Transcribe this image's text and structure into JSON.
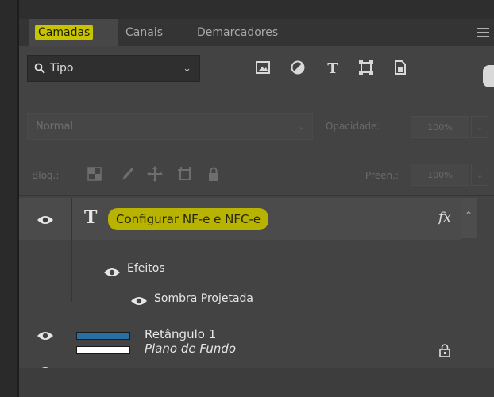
{
  "tabs": [
    {
      "label": "Camadas"
    },
    {
      "label": "Canais"
    },
    {
      "label": "Demarcadores"
    }
  ],
  "filter": {
    "label": "Tipo"
  },
  "blend": {
    "mode": "Normal",
    "opacity_label": "Opacidade:",
    "opacity_value": "100%"
  },
  "lock": {
    "label": "Bloq.:",
    "fill_label": "Preen.:",
    "fill_value": "100%"
  },
  "layers": {
    "text_layer": {
      "name": "Configurar NF-e e NFC-e",
      "fx": "fx"
    },
    "effects": {
      "label": "Efeitos",
      "items": [
        "Sombra Projetada"
      ]
    },
    "rect_layer": {
      "name": "Retângulo 1"
    },
    "background_layer": {
      "name": "Plano de Fundo"
    }
  },
  "colors": {
    "highlight": "#c9c400",
    "panel": "#434343",
    "selected_row": "#4b4b4b",
    "rect_thumb": "#2a6fa3"
  }
}
